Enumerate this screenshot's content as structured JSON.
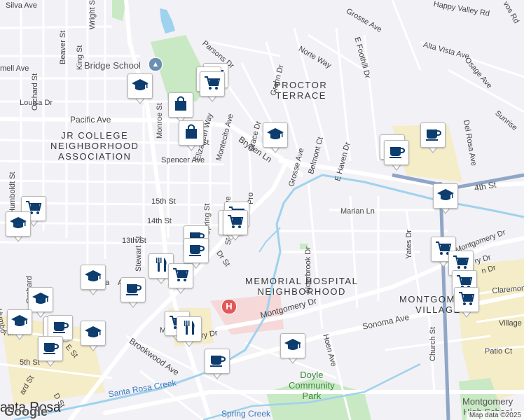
{
  "map": {
    "neighborhoods": [
      {
        "text": "PROCTOR\nTERRACE"
      },
      {
        "text": "JR COLLEGE\nNEIGHBORHOOD\nASSOCIATION"
      },
      {
        "text": "MEMORIAL HOSPITAL\nNEIGHBORHOOD"
      },
      {
        "text": "MONTGOMERY\nVILLAGE"
      }
    ],
    "city_label": "anta Rosa",
    "pois": {
      "bridge_school": "Bridge School",
      "doyle_park": "Doyle\nCommunity\nPark",
      "montgomery_hs": "Montgomery\nHigh School"
    },
    "water": {
      "santa_rosa_creek": "Santa Rosa Creek",
      "spring_creek": "Spring Creek"
    },
    "streets": [
      "Silva Ave",
      "Wright St",
      "Beaver St",
      "King St",
      "Orchard St",
      "Louisa Dr",
      "Pacific Ave",
      "Humboldt St",
      "Spencer Ave",
      "15th St",
      "14th St",
      "13th St",
      "Stewart St",
      "Spring St",
      "Monroe St",
      "Elizabeth Way",
      "Montecito Ave",
      "Parsons Dr",
      "Grahn Dr",
      "Grace Dr",
      "Bryden Ln",
      "St Helena Ave",
      "Grosse Ave",
      "Norte Way",
      "Belmont Ct",
      "E Haven Dr",
      "E Foothill Dr",
      "Alta Vista Ave",
      "Osage Ave",
      "Sunrise",
      "Del Rosa Ave",
      "Happy Valley Rd",
      "4th St",
      "Marian Ln",
      "Alderbrook Dr",
      "Yates Dr",
      "Montgomery Dr",
      "Sonoma Ave",
      "Church St",
      "Claremont",
      "Village",
      "Patio Ct",
      "Hoen Ave",
      "Brookwood Ave",
      "5th St",
      "D St",
      "E St",
      "7th",
      "Humbo",
      "Orchard",
      "Montgomery Dr",
      "Mc",
      "ry Dr",
      "Pro",
      "Dr St",
      "St",
      "Ave",
      "mell Ave",
      "Ca",
      "ard St",
      "Grosse Ave",
      "vos Rd",
      "n Dr",
      "ry Dr"
    ],
    "highway_shield": "",
    "google_logo": "Google",
    "attribution": "Map data ©2025"
  },
  "markers": [
    {
      "type": "school"
    },
    {
      "type": "shopping"
    },
    {
      "type": "bag"
    },
    {
      "type": "bag"
    },
    {
      "type": "grocery"
    },
    {
      "type": "grocery"
    },
    {
      "type": "school"
    },
    {
      "type": "cafe"
    },
    {
      "type": "cafe"
    },
    {
      "type": "cafe"
    },
    {
      "type": "school"
    },
    {
      "type": "bag"
    },
    {
      "type": "shopping"
    },
    {
      "type": "cafe"
    },
    {
      "type": "grocery"
    },
    {
      "type": "school"
    },
    {
      "type": "grocery"
    },
    {
      "type": "restaurant"
    },
    {
      "type": "grocery"
    },
    {
      "type": "school"
    },
    {
      "type": "cafe"
    },
    {
      "type": "school"
    },
    {
      "type": "cafe"
    },
    {
      "type": "grocery"
    },
    {
      "type": "restaurant"
    },
    {
      "type": "cafe"
    },
    {
      "type": "school"
    },
    {
      "type": "cafe"
    },
    {
      "type": "school"
    },
    {
      "type": "cafe"
    },
    {
      "type": "cafe"
    },
    {
      "type": "grocery"
    },
    {
      "type": "grocery"
    },
    {
      "type": "grocery"
    },
    {
      "type": "school"
    },
    {
      "type": "grocery"
    }
  ],
  "colors": {
    "background": "#f2f1f5",
    "park": "#c9e9c4",
    "water": "#9fd2ee",
    "highway": "#8fa6c6",
    "marker_icon": "#0d3d6e",
    "commercial": "#f5ecc8",
    "hospital_area": "#f6d8d8"
  }
}
